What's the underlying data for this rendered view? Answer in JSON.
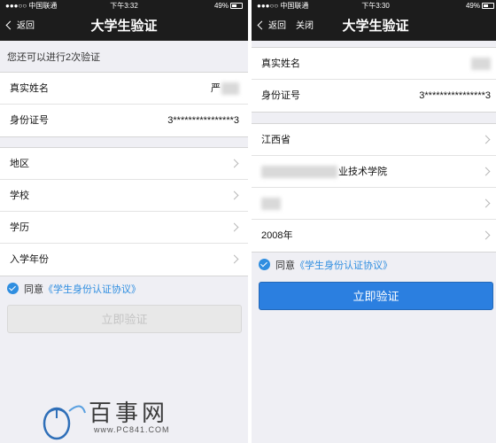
{
  "left": {
    "status": {
      "carrier": "●●●○○ 中国联通",
      "time": "下午3:32",
      "battery": "49%"
    },
    "nav": {
      "back_label": "返回",
      "title": "大学生验证"
    },
    "notice": "您还可以进行2次验证",
    "identity": {
      "name_label": "真实姓名",
      "name_value": "严",
      "id_label": "身份证号",
      "id_value": "3****************3"
    },
    "fields": [
      {
        "label": "地区"
      },
      {
        "label": "学校"
      },
      {
        "label": "学历"
      },
      {
        "label": "入学年份"
      }
    ],
    "agree": {
      "text": "同意",
      "link": "《学生身份认证协议》"
    },
    "submit_label": "立即验证"
  },
  "right": {
    "status": {
      "carrier": "●●●○○ 中国联通",
      "time": "下午3:30",
      "battery": "49%"
    },
    "nav": {
      "back_label": "返回",
      "close_label": "关闭",
      "title": "大学生验证"
    },
    "identity": {
      "name_label": "真实姓名",
      "id_label": "身份证号",
      "id_value": "3****************3"
    },
    "fields": [
      {
        "value": "江西省"
      },
      {
        "value": "业技术学院"
      },
      {
        "value": ""
      },
      {
        "value": "2008年"
      }
    ],
    "agree": {
      "text": "同意",
      "link": "《学生身份认证协议》"
    },
    "submit_label": "立即验证"
  },
  "watermark": {
    "text": "百事网",
    "url": "www.PC841.COM"
  },
  "colors": {
    "accent": "#2f8ee0",
    "button": "#2b7fe0",
    "navbar": "#1c1c1c",
    "background": "#efeff4"
  }
}
